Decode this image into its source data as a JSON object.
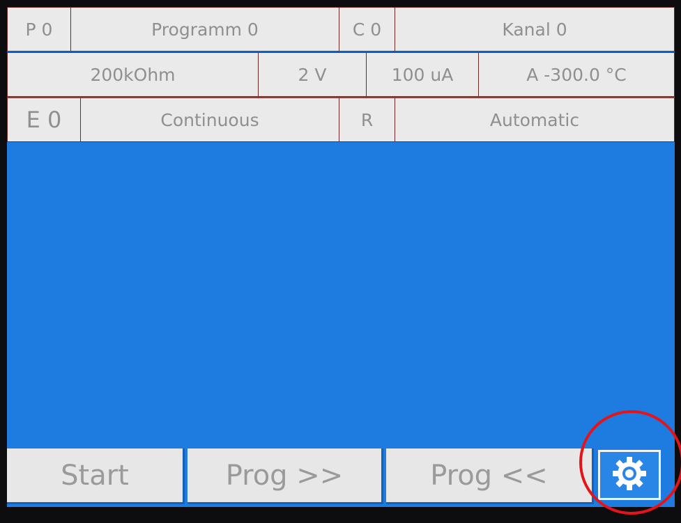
{
  "header": {
    "row1": {
      "program_id": "P 0",
      "program_name": "Programm 0",
      "channel_id": "C 0",
      "channel_name": "Kanal 0"
    },
    "row2": {
      "resistance": "200kOhm",
      "voltage": "2 V",
      "current": "100 uA",
      "temperature": "A -300.0 °C"
    },
    "row3": {
      "mode_id": "E 0",
      "mode_name": "Continuous",
      "range_id": "R",
      "range_name": "Automatic"
    }
  },
  "buttons": {
    "start": "Start",
    "prog_next": "Prog >>",
    "prog_prev": "Prog <<"
  },
  "icons": {
    "settings": "gear-icon"
  },
  "colors": {
    "screen_blue": "#1e7be0",
    "cell_bg": "#eaeaea",
    "cell_border": "#6b2a24",
    "highlight_red": "#e3151a"
  }
}
